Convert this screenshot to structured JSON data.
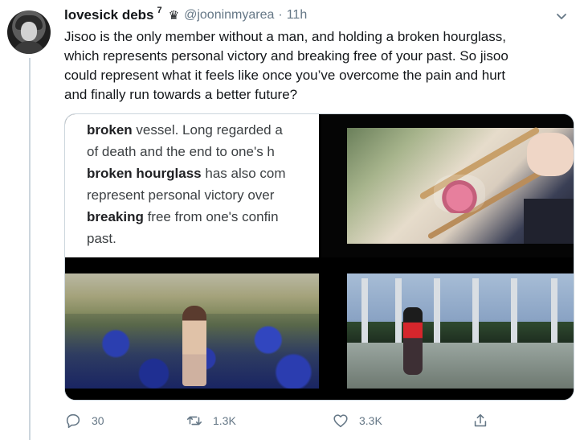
{
  "author": {
    "display_name": "lovesick debs",
    "name_suffix": "7",
    "badge_icon": "crown-icon",
    "handle": "@jooninmyarea",
    "separator": "·",
    "time": "11h"
  },
  "tweet": {
    "lines": [
      "Jisoo is the only member without a man, and holding a broken hourglass,",
      "which represents personal victory and breaking free of your past. So jisoo",
      "could represent what it feels like once you’ve overcome the pain and hurt",
      "and finally run towards a better future?"
    ]
  },
  "media": {
    "quote": {
      "l1_bold": "broken",
      "l1_rest": " vessel. Long regarded a",
      "l2": "of death and the end to one's h",
      "l3_bold": "broken hourglass",
      "l3_rest": " has also com",
      "l4": "represent personal victory over",
      "l5_bold": "breaking",
      "l5_rest": " free from one's confin",
      "l6": "past."
    }
  },
  "actions": {
    "reply_count": "30",
    "retweet_count": "1.3K",
    "like_count": "3.3K"
  },
  "colors": {
    "text": "#14171a",
    "secondary": "#657786",
    "border": "#ccd6dd"
  }
}
